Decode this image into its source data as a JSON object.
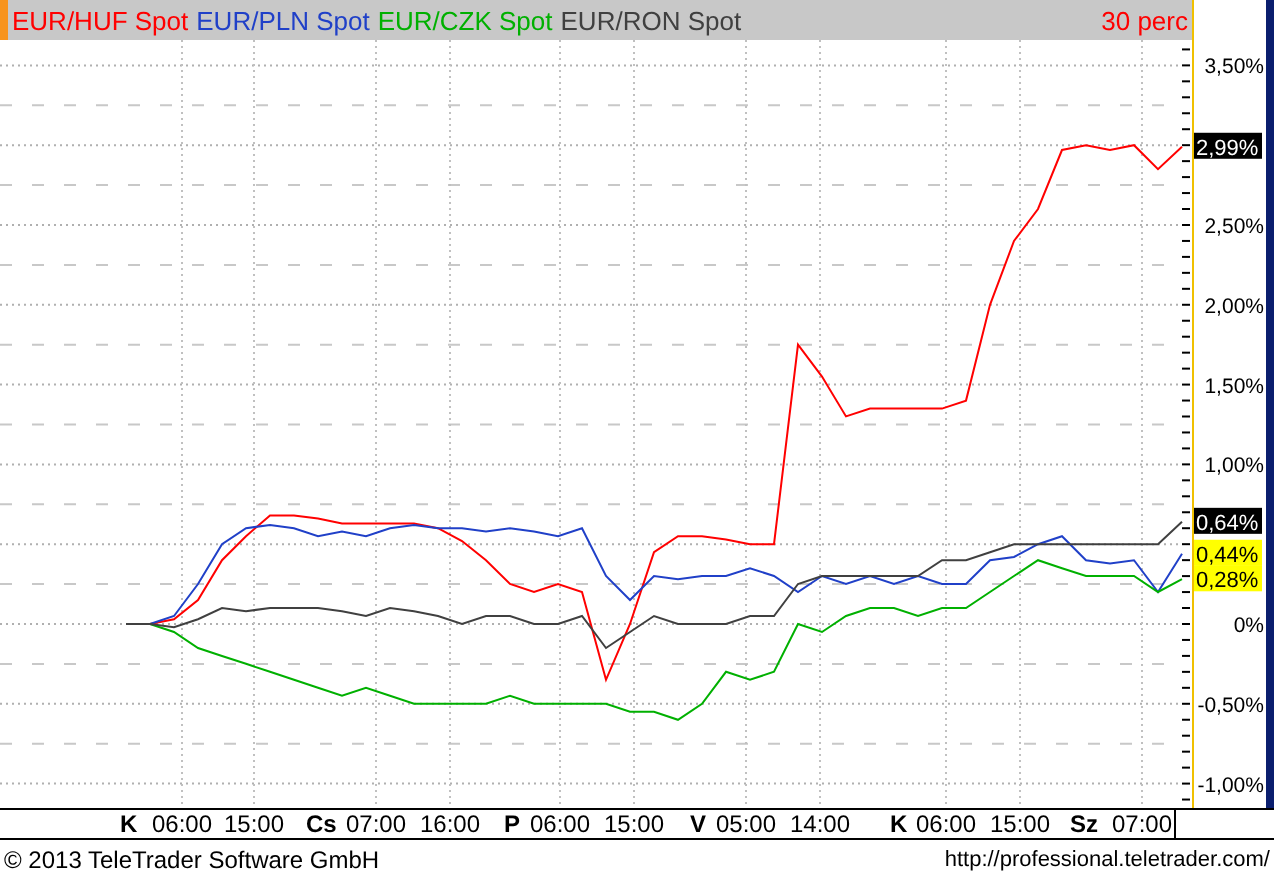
{
  "header": {
    "interval": "30 perc"
  },
  "chart_data": {
    "type": "line",
    "grid": true,
    "series": [
      {
        "name": "EUR/HUF Spot",
        "color": "#ff0000",
        "values": [
          0,
          0,
          0.03,
          0.15,
          0.4,
          0.55,
          0.68,
          0.68,
          0.66,
          0.63,
          0.63,
          0.63,
          0.63,
          0.6,
          0.52,
          0.4,
          0.25,
          0.2,
          0.25,
          0.2,
          -0.35,
          0.0,
          0.45,
          0.55,
          0.55,
          0.53,
          0.5,
          0.5,
          1.75,
          1.55,
          1.3,
          1.35,
          1.35,
          1.35,
          1.35,
          1.4,
          2.0,
          2.4,
          2.6,
          2.97,
          3.0,
          2.97,
          3.0,
          2.85,
          2.99
        ]
      },
      {
        "name": "EUR/PLN Spot",
        "color": "#2040c8",
        "values": [
          0,
          0,
          0.05,
          0.25,
          0.5,
          0.6,
          0.62,
          0.6,
          0.55,
          0.58,
          0.55,
          0.6,
          0.62,
          0.6,
          0.6,
          0.58,
          0.6,
          0.58,
          0.55,
          0.6,
          0.3,
          0.15,
          0.3,
          0.28,
          0.3,
          0.3,
          0.35,
          0.3,
          0.2,
          0.3,
          0.25,
          0.3,
          0.25,
          0.3,
          0.25,
          0.25,
          0.4,
          0.42,
          0.5,
          0.55,
          0.4,
          0.38,
          0.4,
          0.2,
          0.44
        ]
      },
      {
        "name": "EUR/CZK Spot",
        "color": "#00b000",
        "values": [
          0,
          0,
          -0.05,
          -0.15,
          -0.2,
          -0.25,
          -0.3,
          -0.35,
          -0.4,
          -0.45,
          -0.4,
          -0.45,
          -0.5,
          -0.5,
          -0.5,
          -0.5,
          -0.45,
          -0.5,
          -0.5,
          -0.5,
          -0.5,
          -0.55,
          -0.55,
          -0.6,
          -0.5,
          -0.3,
          -0.35,
          -0.3,
          0.0,
          -0.05,
          0.05,
          0.1,
          0.1,
          0.05,
          0.1,
          0.1,
          0.2,
          0.3,
          0.4,
          0.35,
          0.3,
          0.3,
          0.3,
          0.2,
          0.28
        ]
      },
      {
        "name": "EUR/RON Spot",
        "color": "#404040",
        "values": [
          0,
          0,
          -0.02,
          0.03,
          0.1,
          0.08,
          0.1,
          0.1,
          0.1,
          0.08,
          0.05,
          0.1,
          0.08,
          0.05,
          0.0,
          0.05,
          0.05,
          0.0,
          0.0,
          0.05,
          -0.15,
          -0.05,
          0.05,
          0.0,
          0.0,
          0.0,
          0.05,
          0.05,
          0.25,
          0.3,
          0.3,
          0.3,
          0.3,
          0.3,
          0.4,
          0.4,
          0.45,
          0.5,
          0.5,
          0.5,
          0.5,
          0.5,
          0.5,
          0.5,
          0.64
        ]
      }
    ],
    "ylim": [
      -1.153,
      3.659
    ],
    "yticks": [
      {
        "value": 3.5,
        "label": "3,50%"
      },
      {
        "value": 2.5,
        "label": "2,50%"
      },
      {
        "value": 2,
        "label": "2,00%"
      },
      {
        "value": 1.5,
        "label": "1,50%"
      },
      {
        "value": 1,
        "label": "1,00%"
      },
      {
        "value": 0,
        "label": "0%"
      },
      {
        "value": -0.5,
        "label": "-0,50%"
      },
      {
        "value": -1,
        "label": "-1,00%"
      }
    ]
  },
  "last_values": [
    {
      "text": "2,99%",
      "kind": "dark"
    },
    {
      "text": "0,64%",
      "kind": "dark"
    },
    {
      "text": "0,44%",
      "kind": "highlight"
    },
    {
      "text": "0,28%",
      "kind": "highlight"
    }
  ],
  "x_axis": [
    {
      "day": "K",
      "times": [
        "06:00",
        "15:00"
      ]
    },
    {
      "day": "Cs",
      "times": [
        "07:00",
        "16:00"
      ]
    },
    {
      "day": "P",
      "times": [
        "06:00",
        "15:00"
      ]
    },
    {
      "day": "V",
      "times": [
        "05:00",
        "14:00"
      ]
    },
    {
      "day": "K",
      "times": [
        "06:00",
        "15:00"
      ]
    },
    {
      "day": "Sz",
      "times": [
        "07:00"
      ]
    }
  ],
  "footer": {
    "copyright": "© 2013 TeleTrader Software GmbH",
    "url": "http://professional.teletrader.com/"
  }
}
